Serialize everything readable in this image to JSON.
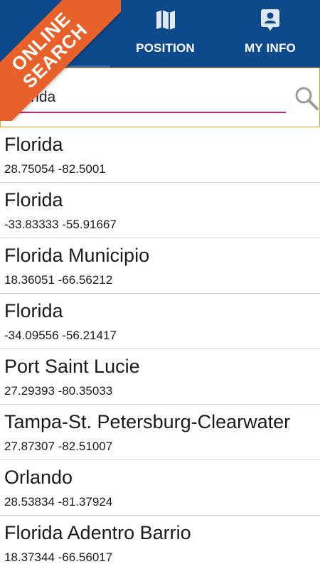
{
  "ribbon": {
    "line1": "ONLINE",
    "line2": "SEARCH"
  },
  "tabs": [
    {
      "label": "SEARCH",
      "icon": "search-tab-icon",
      "selected": true
    },
    {
      "label": "POSITION",
      "icon": "map-icon",
      "selected": false
    },
    {
      "label": "MY INFO",
      "icon": "contact-card-icon",
      "selected": false
    }
  ],
  "search": {
    "value": "Florida",
    "placeholder": ""
  },
  "colors": {
    "tabbar_bg": "#0d4a8c",
    "ribbon_bg": "#e8602a",
    "search_border": "#f0a21e",
    "input_underline": "#d81b71",
    "selected_tab_text": "#f06fb0"
  },
  "results": [
    {
      "name": "Florida",
      "coords": "28.75054 -82.5001"
    },
    {
      "name": "Florida",
      "coords": "-33.83333 -55.91667"
    },
    {
      "name": "Florida Municipio",
      "coords": "18.36051 -66.56212"
    },
    {
      "name": "Florida",
      "coords": "-34.09556 -56.21417"
    },
    {
      "name": "Port Saint Lucie",
      "coords": "27.29393 -80.35033"
    },
    {
      "name": "Tampa-St. Petersburg-Clearwater",
      "coords": "27.87307 -82.51007"
    },
    {
      "name": "Orlando",
      "coords": "28.53834 -81.37924"
    },
    {
      "name": "Florida Adentro Barrio",
      "coords": "18.37344 -66.56017"
    }
  ]
}
